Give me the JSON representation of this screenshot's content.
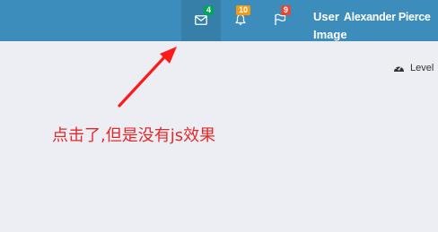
{
  "header": {
    "messages_badge": "4",
    "notifications_badge": "10",
    "tasks_badge": "9",
    "user_image_label_line1": "User",
    "user_name": "Alexander Pierce",
    "user_image_label_line2": "Image"
  },
  "breadcrumb": {
    "level_label": "Level"
  },
  "annotation": {
    "text": "点击了,但是没有js效果"
  },
  "colors": {
    "header_bg": "#3c8dbc",
    "active_item_bg": "#367fa9",
    "badge_green": "#00a65a",
    "badge_orange": "#f39c12",
    "badge_red": "#dd4b39",
    "annotation_red": "#e32a2a",
    "page_bg": "#edeef3"
  },
  "icons": {
    "messages": "envelope-icon",
    "notifications": "bell-icon",
    "tasks": "flag-icon",
    "level": "dashboard-gauge-icon"
  }
}
